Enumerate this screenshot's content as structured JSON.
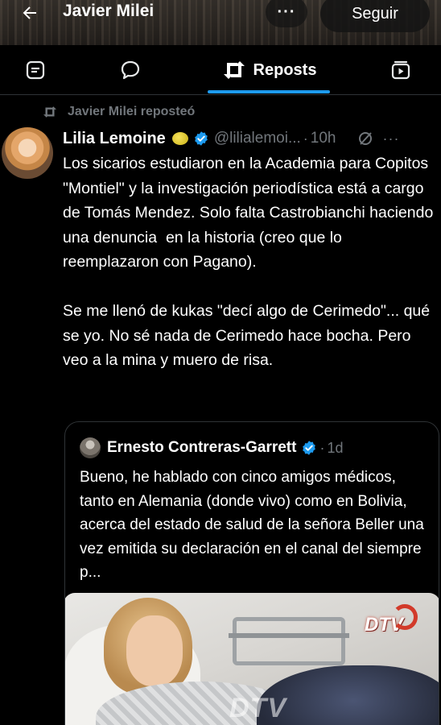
{
  "header": {
    "title": "Javier Milei",
    "follow_label": "Seguir",
    "more_label": "···"
  },
  "tabs": {
    "active_label": "Reposts"
  },
  "repost": {
    "label": "Javier Milei reposteó"
  },
  "tweet": {
    "author_name": "Lilia Lemoine",
    "handle": "@lilialemoi...",
    "time": "10h",
    "text": "Los sicarios estudiaron en la Academia para Copitos \"Montiel\" y la investigación periodística está a cargo de Tomás Mendez. Solo falta Castrobianchi haciendo una denuncia  en la historia (creo que lo reemplazaron con Pagano).\n\nSe me llenó de kukas \"decí algo de Cerimedo\"... qué se yo. No sé nada de Cerimedo hace bocha. Pero veo a la mina y muero de risa."
  },
  "quote": {
    "author_name": "Ernesto Contreras-Garrett",
    "time": "1d",
    "text": "Bueno, he hablado con cinco amigos médicos, tanto en Alemania (donde vivo) como en Bolivia, acerca del estado de salud de la señora Beller una vez emitida su declaración en el canal del siempre p...",
    "image_logo": "DTV",
    "image_watermark": "DTV"
  },
  "colors": {
    "accent": "#1d9bf0",
    "secondary_text": "#71767b",
    "background": "#000000"
  }
}
